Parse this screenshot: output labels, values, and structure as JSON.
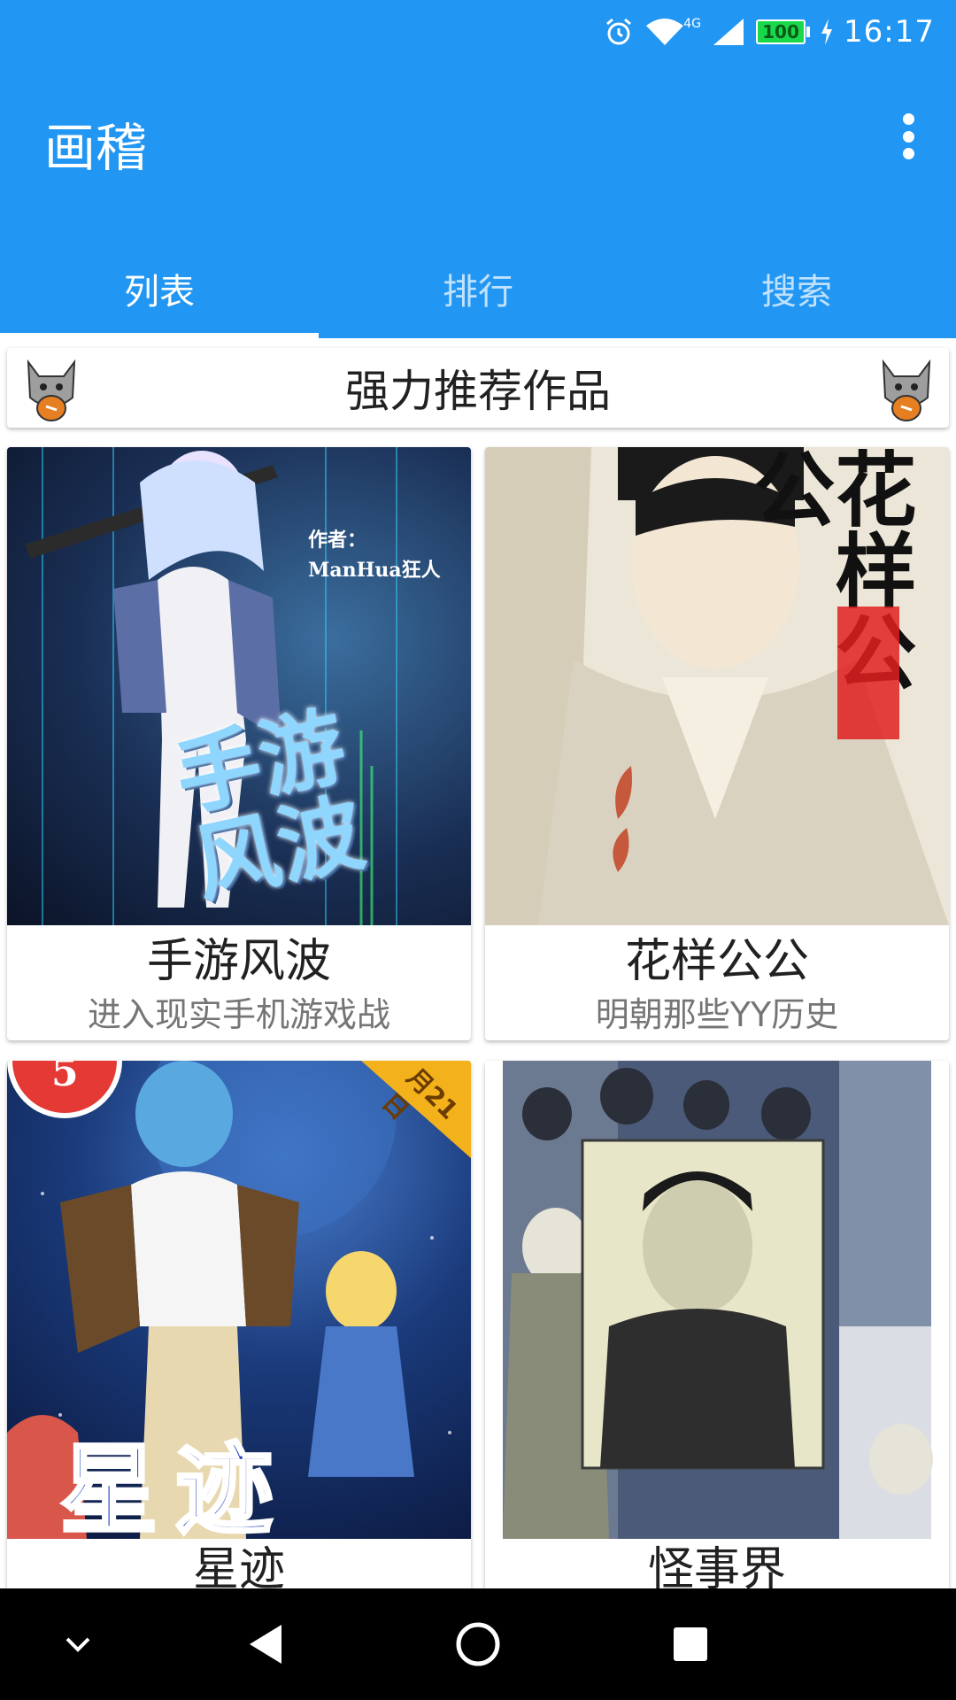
{
  "status_bar": {
    "time": "16:17",
    "battery": "100",
    "network": "4G",
    "icons": [
      "alarm-icon",
      "wifi-icon",
      "signal-icon",
      "battery-icon",
      "charging-icon"
    ]
  },
  "app_bar": {
    "title": "画稽",
    "menu_icon": "more-vert-icon"
  },
  "tabs": [
    {
      "label": "列表",
      "active": true
    },
    {
      "label": "排行",
      "active": false
    },
    {
      "label": "搜索",
      "active": false
    }
  ],
  "banner": {
    "title": "强力推荐作品"
  },
  "comics": [
    {
      "name": "手游风波",
      "desc": "进入现实手机游戏战",
      "cover_text": "手游风波",
      "cover_author": "作者：ManHua狂人"
    },
    {
      "name": "花样公公",
      "desc": "明朝那些YY历史",
      "cover_text": "花样公公"
    },
    {
      "name": "星迹",
      "desc": "",
      "cover_text": "星迹",
      "cover_corner": "月21日",
      "cover_number": "5"
    },
    {
      "name": "怪事界",
      "desc": ""
    }
  ],
  "nav_bar": {
    "icons": [
      "collapse-icon",
      "back-icon",
      "home-icon",
      "recents-icon"
    ]
  },
  "colors": {
    "primary": "#2196f3",
    "text": "#212121",
    "subtext": "#757575"
  }
}
